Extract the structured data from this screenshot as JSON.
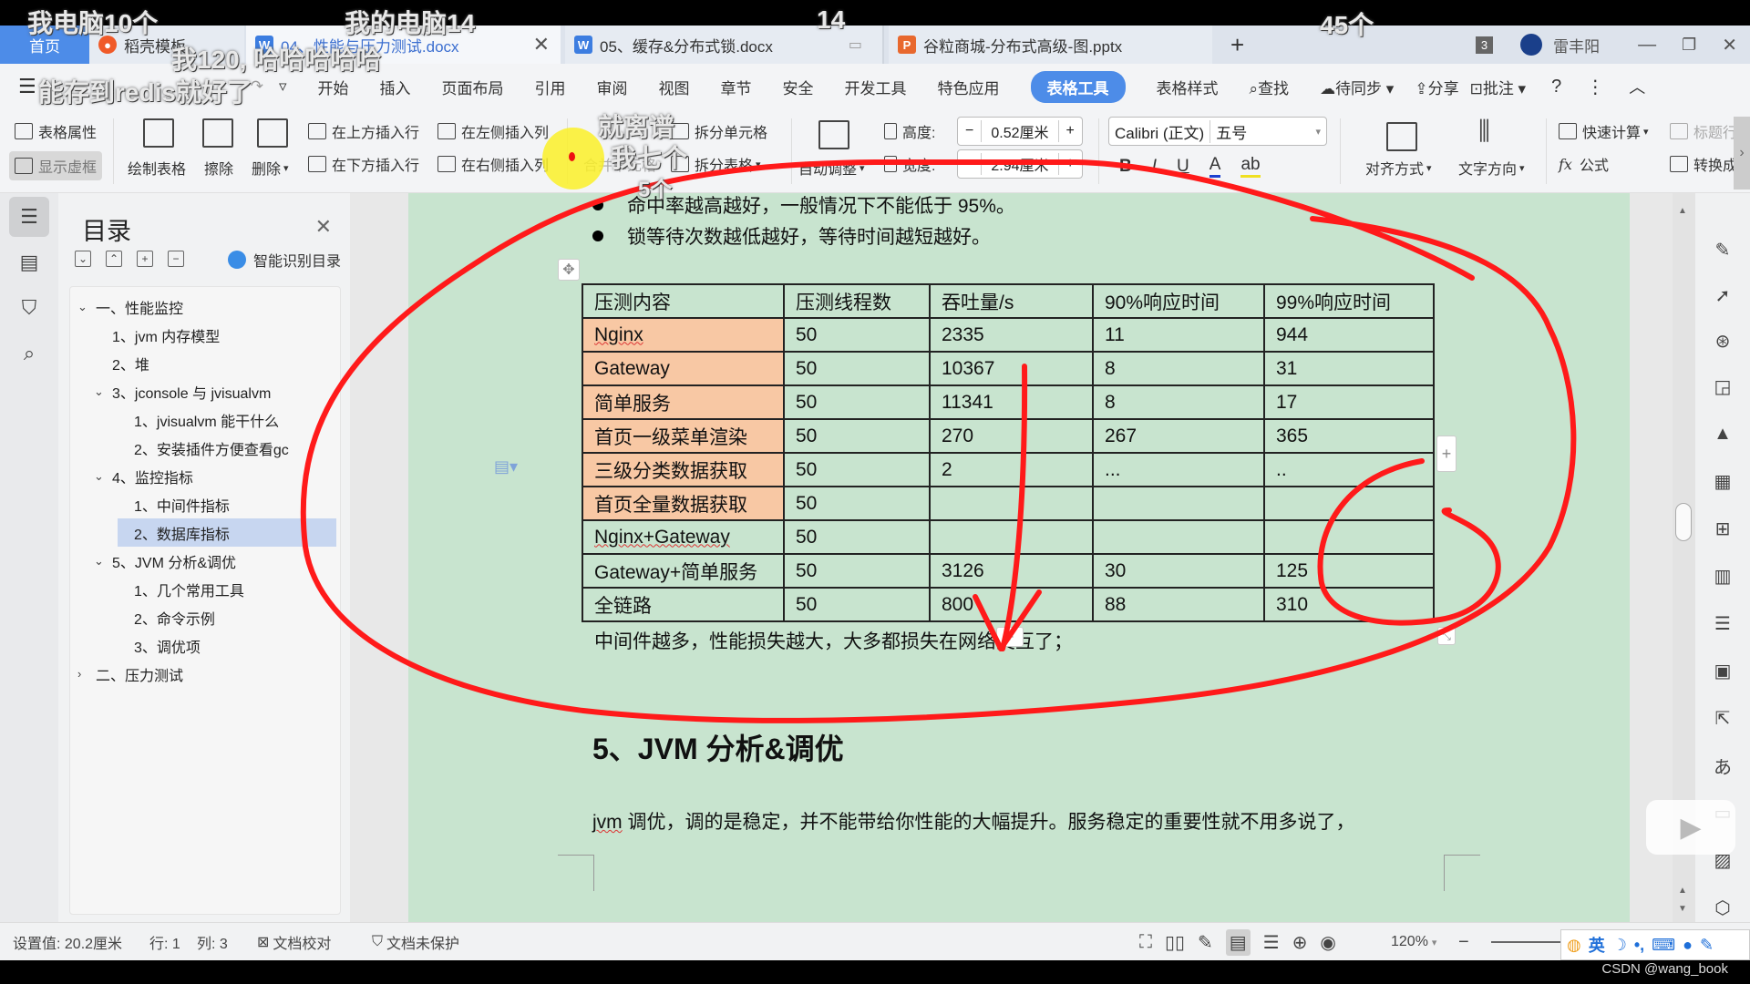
{
  "overlay_comments": [
    "我电脑10个",
    "我的电脑14",
    "14",
    "45个",
    "我120, 哈哈哈哈哈",
    "能存到redis就好了",
    "就离谱",
    "我七个",
    "5个"
  ],
  "tabs": {
    "home": "首页",
    "draft": "稻壳模板",
    "active_doc": "04、性能与压力测试.docx",
    "doc2": "05、缓存&分布式锁.docx",
    "ppt": "谷粒商城-分布式高级-图.pptx",
    "new_tab": "+",
    "window_count": "3",
    "user_name": "雷丰阳"
  },
  "menu": {
    "items": [
      "开始",
      "插入",
      "页面布局",
      "引用",
      "审阅",
      "视图",
      "章节",
      "安全",
      "开发工具",
      "特色应用",
      "表格工具",
      "表格样式"
    ],
    "active": "表格工具",
    "search": "查找",
    "sync": "待同步",
    "share": "分享",
    "comment": "批注"
  },
  "ribbon": {
    "table_props": "表格属性",
    "show_gridlines": "显示虚框",
    "draw_table": "绘制表格",
    "erase": "擦除",
    "delete": "删除",
    "insert_row_above": "在上方插入行",
    "insert_row_below": "在下方插入行",
    "insert_col_left": "在左侧插入列",
    "insert_col_right": "在右侧插入列",
    "merge_cells": "合并单元格",
    "split_cells": "拆分单元格",
    "split_table": "拆分表格",
    "auto_fit": "自动调整",
    "height_label": "高度:",
    "height_value": "0.52厘米",
    "width_label": "宽度:",
    "width_value": "2.94厘米",
    "font_name": "Calibri (正文)",
    "font_size": "五号",
    "align": "对齐方式",
    "text_direction": "文字方向",
    "quick_calc": "快速计算",
    "formula": "公式",
    "title_row": "标题行",
    "convert": "转换成"
  },
  "toc": {
    "title": "目录",
    "smart": "智能识别目录",
    "items": [
      {
        "label": "一、性能监控",
        "level": 0,
        "expanded": true
      },
      {
        "label": "1、jvm 内存模型",
        "level": 1
      },
      {
        "label": "2、堆",
        "level": 1
      },
      {
        "label": "3、jconsole 与 jvisualvm",
        "level": 1,
        "expanded": true
      },
      {
        "label": "1、jvisualvm 能干什么",
        "level": 2
      },
      {
        "label": "2、安装插件方便查看gc",
        "level": 2
      },
      {
        "label": "4、监控指标",
        "level": 1,
        "expanded": true
      },
      {
        "label": "1、中间件指标",
        "level": 2
      },
      {
        "label": "2、数据库指标",
        "level": 2,
        "selected": true
      },
      {
        "label": "5、JVM 分析&调优",
        "level": 1,
        "expanded": true
      },
      {
        "label": "1、几个常用工具",
        "level": 2
      },
      {
        "label": "2、命令示例",
        "level": 2
      },
      {
        "label": "3、调优项",
        "level": 2
      },
      {
        "label": "二、压力测试",
        "level": 0,
        "expanded": false
      }
    ]
  },
  "document": {
    "bullets": [
      "命中率越高越好，一般情况下不能低于 95%。",
      "锁等待次数越低越好，等待时间越短越好。"
    ],
    "table": {
      "headers": [
        "压测内容",
        "压测线程数",
        "吞吐量/s",
        "90%响应时间",
        "99%响应时间"
      ],
      "rows": [
        [
          "Nginx",
          "50",
          "2335",
          "11",
          "944"
        ],
        [
          "Gateway",
          "50",
          "10367",
          "8",
          "31"
        ],
        [
          "简单服务",
          "50",
          "11341",
          "8",
          "17"
        ],
        [
          "首页一级菜单渲染",
          "50",
          "270",
          "267",
          "365"
        ],
        [
          "三级分类数据获取",
          "50",
          "2",
          "...",
          ".."
        ],
        [
          "首页全量数据获取",
          "50",
          "",
          "",
          ""
        ],
        [
          "Nginx+Gateway",
          "50",
          "",
          "",
          ""
        ],
        [
          "Gateway+简单服务",
          "50",
          "3126",
          "30",
          "125"
        ],
        [
          "全链路",
          "50",
          "800",
          "88",
          "310"
        ]
      ],
      "highlight_rows": 6,
      "highlight_color": "#f8c8a4"
    },
    "after_table": "中间件越多，性能损失越大，大多都损失在网络交互了；",
    "heading": "5、JVM 分析&调优",
    "paragraph_word": "jvm",
    "paragraph": " 调优，调的是稳定，并不能带给你性能的大幅提升。服务稳定的重要性就不用多说了，"
  },
  "statusbar": {
    "setting": "设置值: 20.2厘米",
    "row": "行: 1",
    "col": "列: 3",
    "proofread": "文档校对",
    "protect": "文档未保护",
    "zoom": "120%",
    "ime_lang": "英"
  },
  "watermark": "CSDN @wang_book",
  "colors": {
    "accent": "#4d8ce8",
    "page_bg": "#c8e4cf",
    "annotation": "#ff1a1a"
  }
}
